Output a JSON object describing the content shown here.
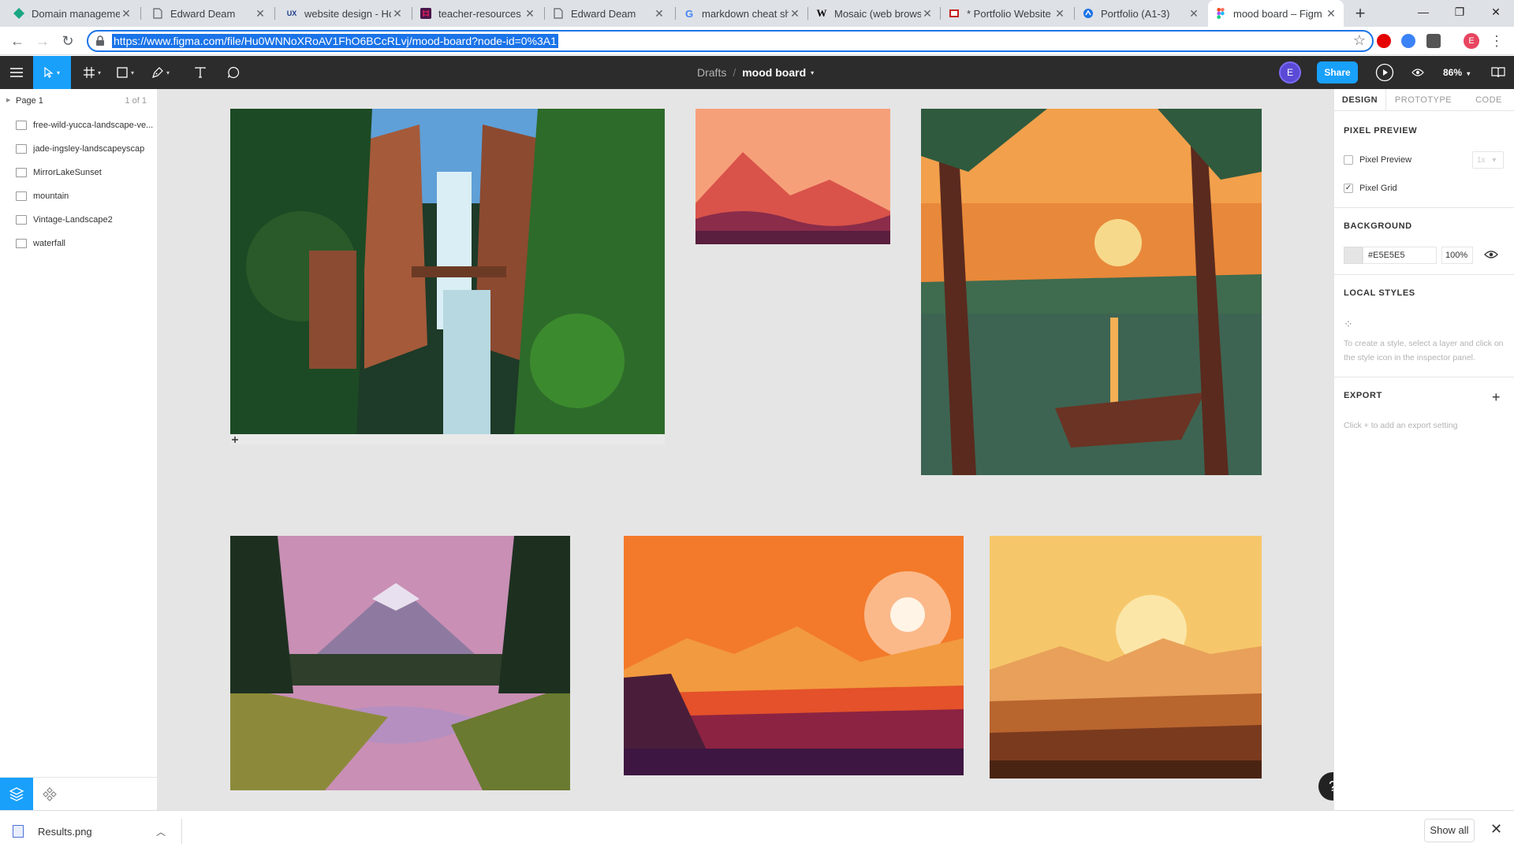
{
  "browser": {
    "tabs": [
      {
        "title": "Domain manageme",
        "icon": "diamond-icon",
        "color": "#1aa683"
      },
      {
        "title": "Edward Deam",
        "icon": "document-icon",
        "color": "#5f6368"
      },
      {
        "title": "website design - Ho",
        "icon": "ux-icon",
        "color": "#1a3a8a"
      },
      {
        "title": "teacher-resources |",
        "icon": "slack-icon",
        "color": "#4a154b"
      },
      {
        "title": "Edward Deam",
        "icon": "document-icon",
        "color": "#5f6368"
      },
      {
        "title": "markdown cheat sh",
        "icon": "google-icon",
        "color": "#4285f4"
      },
      {
        "title": "Mosaic (web brows",
        "icon": "wikipedia-icon",
        "color": "#000000"
      },
      {
        "title": "* Portfolio Website",
        "icon": "portfolio-icon",
        "color": "#c5221f"
      },
      {
        "title": "Portfolio (A1-3)",
        "icon": "portfolio-icon",
        "color": "#1a73e8"
      },
      {
        "title": "mood board – Figm",
        "icon": "figma-icon",
        "color": "#f24e1e",
        "active": true
      }
    ],
    "url": "https://www.figma.com/file/Hu0WNNoXRoAV1FhO6BCcRLvj/mood-board?node-id=0%3A1",
    "profile_initial": "E"
  },
  "figma": {
    "breadcrumb": {
      "project": "Drafts",
      "separator": "/",
      "file": "mood board"
    },
    "avatar_initial": "E",
    "share_label": "Share",
    "zoom": "86%",
    "page": {
      "name": "Page 1",
      "count": "1 of 1"
    },
    "layers": [
      "free-wild-yucca-landscape-ve...",
      "jade-ingsley-landscapeyscap",
      "MirrorLakeSunset",
      "mountain",
      "Vintage-Landscape2",
      "waterfall"
    ],
    "right": {
      "tabs": [
        "DESIGN",
        "PROTOTYPE",
        "CODE"
      ],
      "pixel_preview": {
        "title": "PIXEL PREVIEW",
        "preview_label": "Pixel Preview",
        "preview_checked": false,
        "scale": "1x",
        "grid_label": "Pixel Grid",
        "grid_checked": true
      },
      "background": {
        "title": "BACKGROUND",
        "hex": "#E5E5E5",
        "opacity": "100%"
      },
      "local_styles": {
        "title": "LOCAL STYLES",
        "hint": "To create a style, select a layer and click on the style icon in the inspector panel."
      },
      "export": {
        "title": "EXPORT",
        "hint": "Click + to add an export setting"
      }
    }
  },
  "downloads": {
    "file": "Results.png",
    "show_all": "Show all"
  },
  "colors": {
    "accent": "#18a0fb",
    "toolbar": "#2c2c2c",
    "canvas": "#e5e5e5"
  }
}
